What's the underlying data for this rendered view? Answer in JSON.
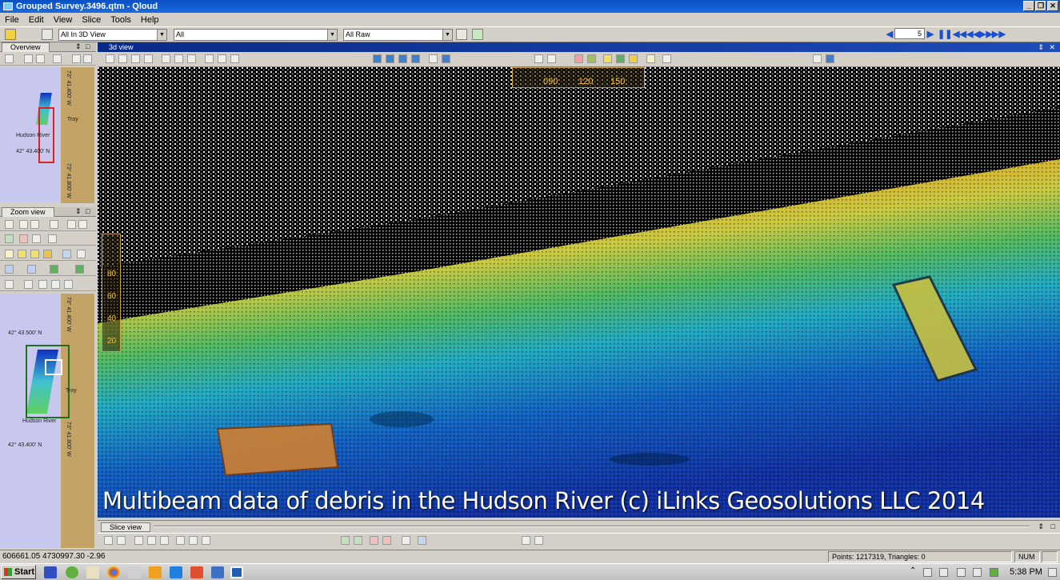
{
  "window": {
    "title": "Grouped Survey.3496.qtm - Qloud",
    "minimize": "_",
    "restore": "❐",
    "close": "✕"
  },
  "menu": [
    "File",
    "Edit",
    "View",
    "Slice",
    "Tools",
    "Help"
  ],
  "toolbar": {
    "view_mode": "All In 3D View",
    "filter": "All",
    "data_mode": "All Raw",
    "frame_value": "5"
  },
  "overview": {
    "tab": "Overview",
    "river_label": "Hudson River",
    "town_label": "Troy",
    "lat_label": "42° 43.400' N",
    "lon_label_a": "73° 41.400' W",
    "lon_label_b": "73° 41.800' W"
  },
  "zoom_view": {
    "tab": "Zoom view",
    "river_label": "Hudson River",
    "town_label": "Troy",
    "lat_label_top": "42° 43.500' N",
    "lat_label_bottom": "42° 43.400' N",
    "lon_label_a": "73° 41.400' W",
    "lon_label_b": "73° 41.800' W"
  },
  "view3d": {
    "title": "3d view",
    "compass_ticks": [
      "090",
      "120",
      "150"
    ],
    "depth_ticks": [
      "80",
      "60",
      "40",
      "20"
    ],
    "caption": "Multibeam data of debris in the Hudson River (c) iLinks Geosolutions LLC 2014"
  },
  "slice_view": {
    "title": "Slice view"
  },
  "status": {
    "coordinates": "606661.05 4730997.30 -2.96",
    "points": "Points: 1217319, Triangles: 0",
    "num": "NUM"
  },
  "taskbar": {
    "start": "Start",
    "clock": "5:38 PM"
  }
}
